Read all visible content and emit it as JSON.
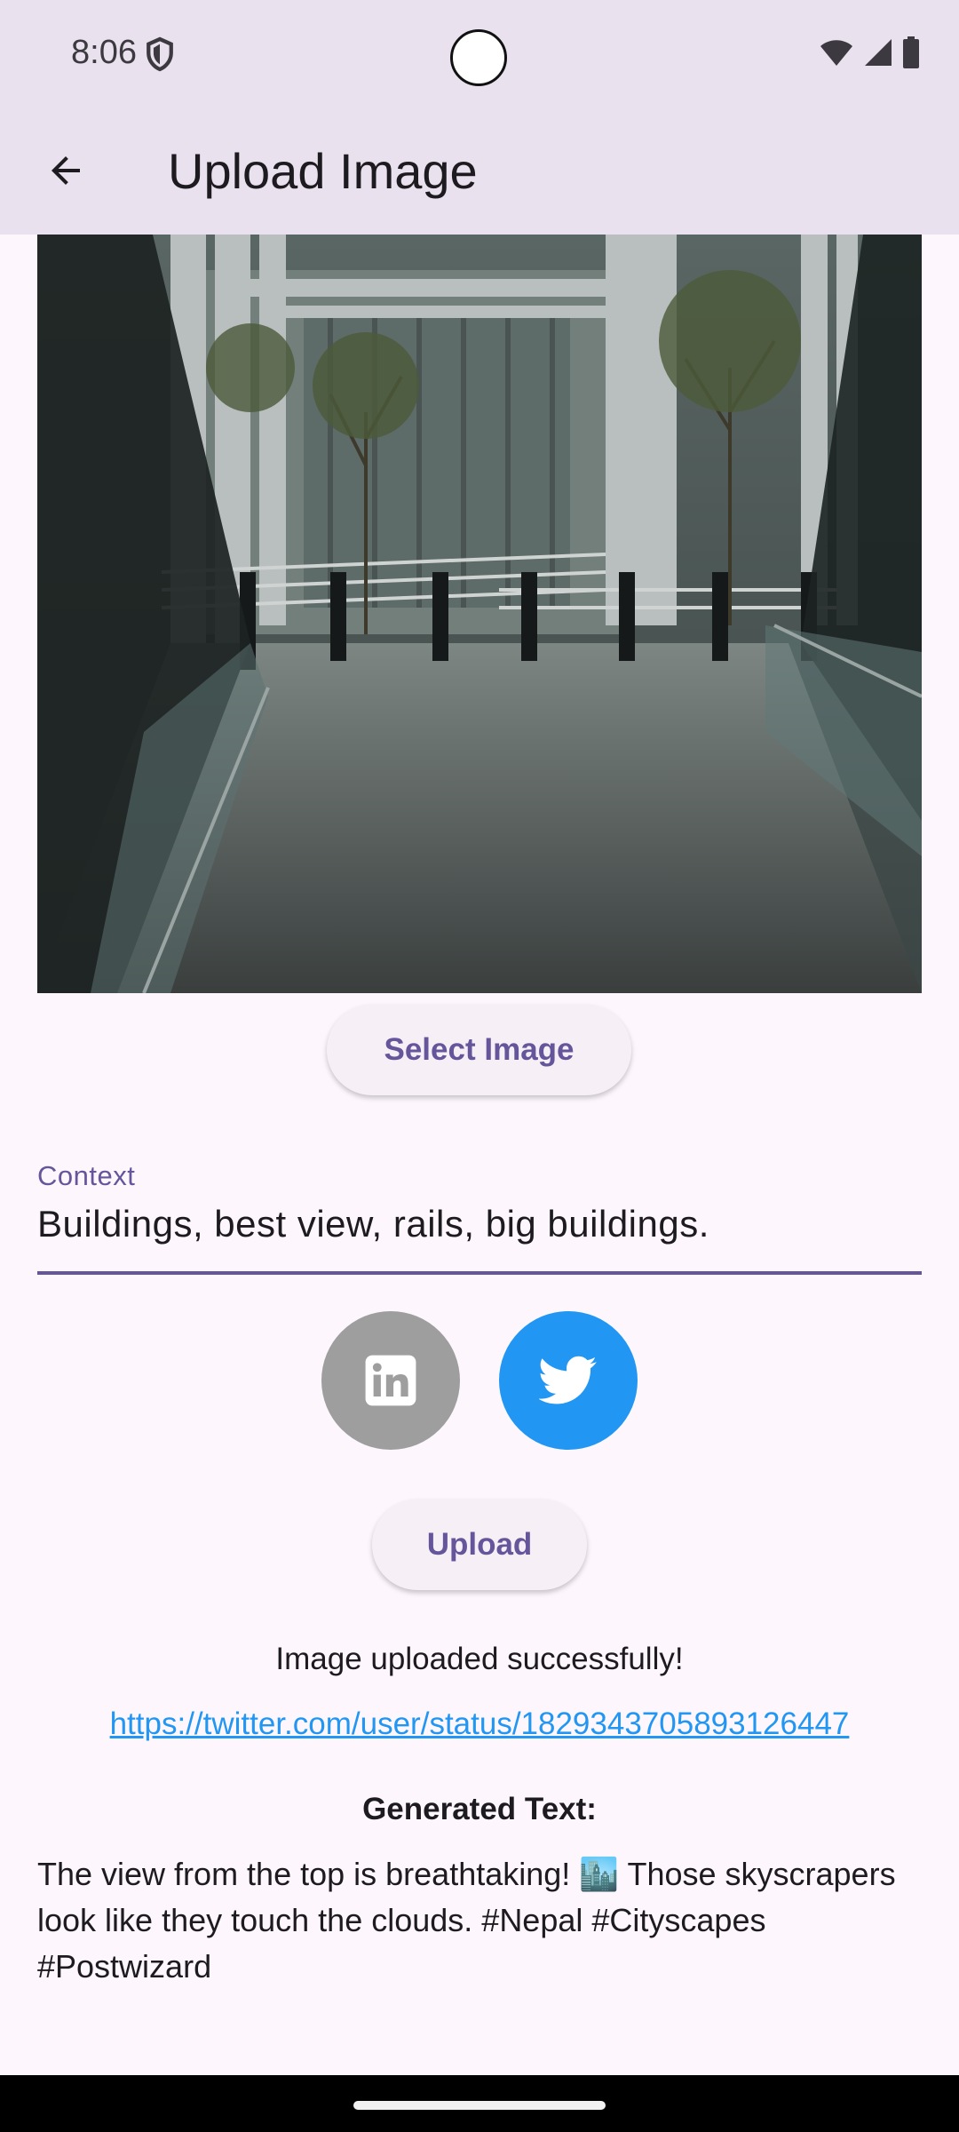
{
  "status_bar": {
    "time": "8:06",
    "icons": [
      "shield-icon",
      "wifi-icon",
      "signal-icon",
      "battery-icon"
    ]
  },
  "app_bar": {
    "back_icon": "arrow-back-icon",
    "title": "Upload Image"
  },
  "preview": {
    "icon": "photo-buildings-walkway"
  },
  "select_button": {
    "label": "Select Image"
  },
  "context_field": {
    "label": "Context",
    "value": "Buildings, best view, rails, big buildings."
  },
  "social": {
    "linkedin": {
      "icon": "linkedin-icon",
      "color": "#9e9e9e"
    },
    "twitter": {
      "icon": "twitter-icon",
      "color": "#2196f3"
    }
  },
  "upload_button": {
    "label": "Upload"
  },
  "result": {
    "message": "Image uploaded successfully!",
    "link": "https://twitter.com/user/status/1829343705893126447"
  },
  "generated": {
    "title": "Generated Text:",
    "text": "The view from the top is breathtaking! 🏙️  Those skyscrapers look like they touch the clouds.  #Nepal #Cityscapes #Postwizard"
  },
  "colors": {
    "accent": "#65559b",
    "app_bar": "#e9e1ee",
    "background": "#fdf7fd",
    "link": "#2196f3"
  }
}
